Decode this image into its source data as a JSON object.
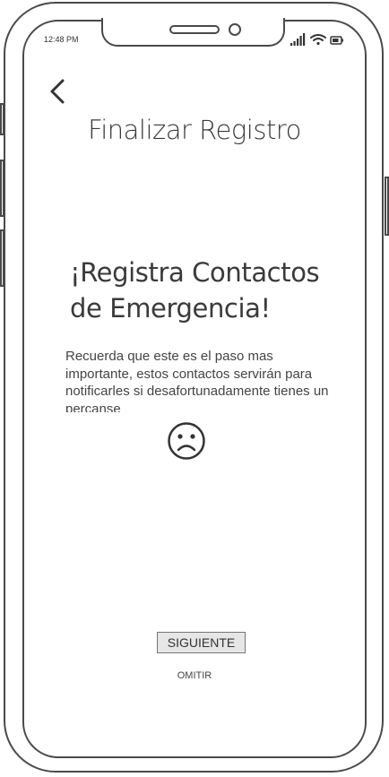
{
  "status_bar": {
    "time": "12:48 PM",
    "icons": [
      "signal-icon",
      "wifi-icon",
      "battery-icon"
    ]
  },
  "header": {
    "back_icon": "chevron-left-icon",
    "title": "Finalizar Registro"
  },
  "main": {
    "headline_line1": "¡Registra Contactos",
    "headline_line2": "de Emergencia!",
    "description": "Recuerda que este es el paso mas importante, estos contactos servirán para notificarles si desafortunadamente tienes un percanse",
    "emoji_icon": "sad-face-icon"
  },
  "actions": {
    "next_label": "SIGUIENTE",
    "skip_label": "OMITIR"
  },
  "colors": {
    "outline": "#4a4a4a",
    "text": "#3a3a3a",
    "button_bg": "#e6e6e6"
  }
}
